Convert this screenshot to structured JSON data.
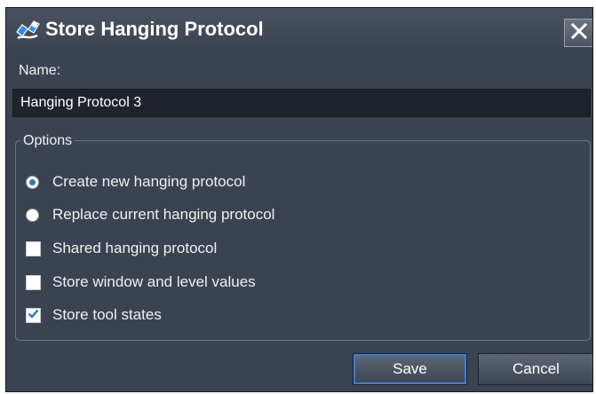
{
  "window": {
    "title": "Store Hanging Protocol",
    "close_icon": "close-icon"
  },
  "name": {
    "label": "Name:",
    "value": "Hanging Protocol 3"
  },
  "options": {
    "legend": "Options",
    "radios": [
      {
        "label": "Create new hanging protocol",
        "selected": true
      },
      {
        "label": "Replace current hanging protocol",
        "selected": false
      }
    ],
    "checkboxes": [
      {
        "label": "Shared hanging protocol",
        "checked": false
      },
      {
        "label": "Store window and level values",
        "checked": false
      },
      {
        "label": "Store tool states",
        "checked": true
      }
    ]
  },
  "buttons": {
    "save_label": "Save",
    "cancel_label": "Cancel"
  },
  "colors": {
    "background": "#3c4350",
    "accent": "#2a78c8",
    "input_background": "#1f242c"
  }
}
